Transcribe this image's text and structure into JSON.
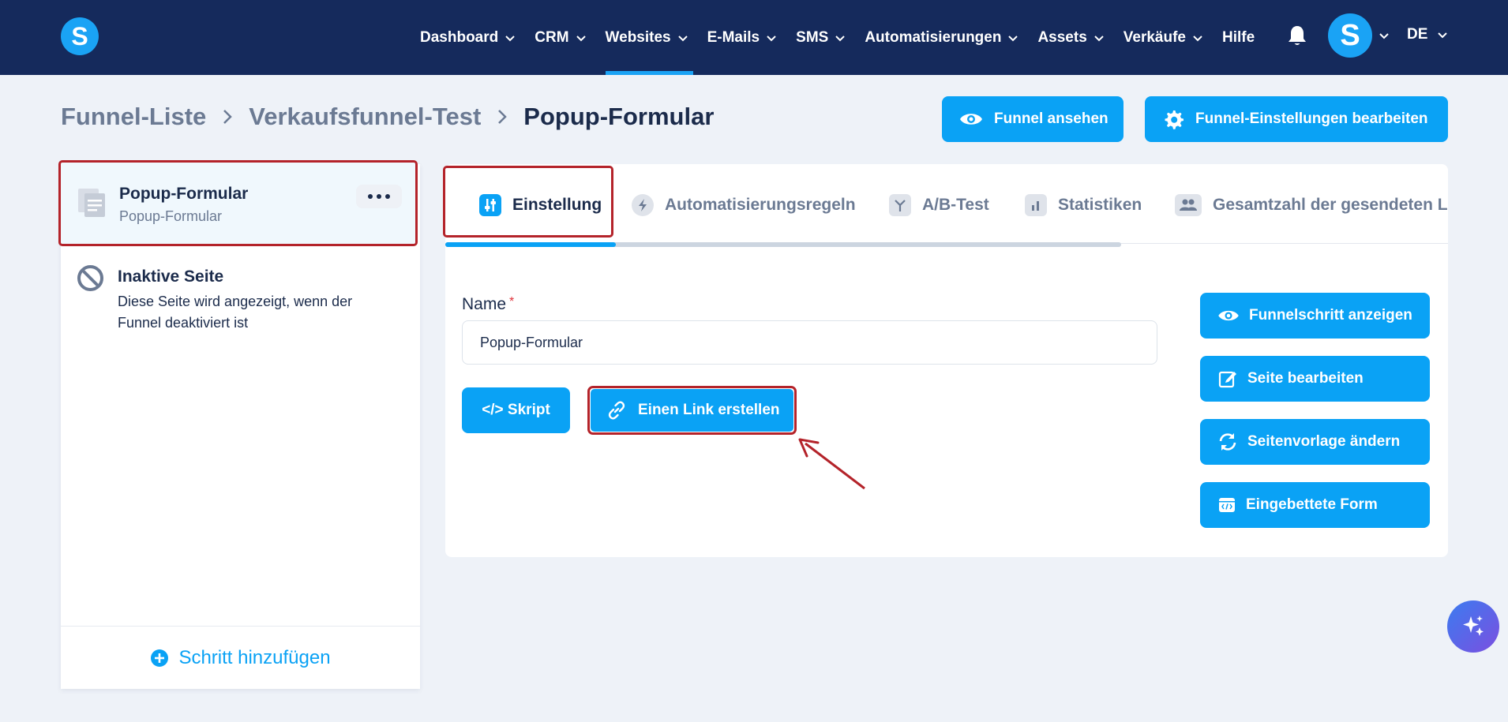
{
  "nav": {
    "logo": "S",
    "items": [
      {
        "label": "Dashboard",
        "active": false
      },
      {
        "label": "CRM",
        "active": false
      },
      {
        "label": "Websites",
        "active": true
      },
      {
        "label": "E-Mails",
        "active": false
      },
      {
        "label": "SMS",
        "active": false
      },
      {
        "label": "Automatisierungen",
        "active": false
      },
      {
        "label": "Assets",
        "active": false
      },
      {
        "label": "Verkäufe",
        "active": false
      },
      {
        "label": "Hilfe",
        "active": false
      }
    ],
    "avatar": "S",
    "language": "DE"
  },
  "breadcrumb": {
    "items": [
      "Funnel-Liste",
      "Verkaufsfunnel-Test",
      "Popup-Formular"
    ]
  },
  "header_actions": {
    "view_funnel": "Funnel ansehen",
    "edit_settings": "Funnel-Einstellungen bearbeiten"
  },
  "steps": {
    "active_step": {
      "title": "Popup-Formular",
      "subtitle": "Popup-Formular"
    },
    "inactive_page": {
      "title": "Inaktive Seite",
      "description": "Diese Seite wird angezeigt, wenn der Funnel deaktiviert ist"
    },
    "add_step": "Schritt hinzufügen"
  },
  "tabs": [
    {
      "label": "Einstellung",
      "icon": "sliders-icon",
      "active": true
    },
    {
      "label": "Automatisierungsregeln",
      "icon": "bolt-icon",
      "active": false
    },
    {
      "label": "A/B-Test",
      "icon": "split-icon",
      "active": false
    },
    {
      "label": "Statistiken",
      "icon": "bar-chart-icon",
      "active": false
    },
    {
      "label": "Gesamtzahl der gesendeten L",
      "icon": "users-icon",
      "active": false
    }
  ],
  "form": {
    "name_label": "Name",
    "required_marker": "*",
    "name_value": "Popup-Formular"
  },
  "actions": {
    "script": "</> Skript",
    "create_link": "Einen Link erstellen"
  },
  "side_actions": {
    "show_step": "Funnelschritt anzeigen",
    "edit_page": "Seite bearbeiten",
    "change_template": "Seitenvorlage ändern",
    "embedded_form": "Eingebettete Form"
  },
  "colors": {
    "nav_bg": "#152a5c",
    "accent": "#0aa2f5",
    "highlight": "#b4232a"
  }
}
